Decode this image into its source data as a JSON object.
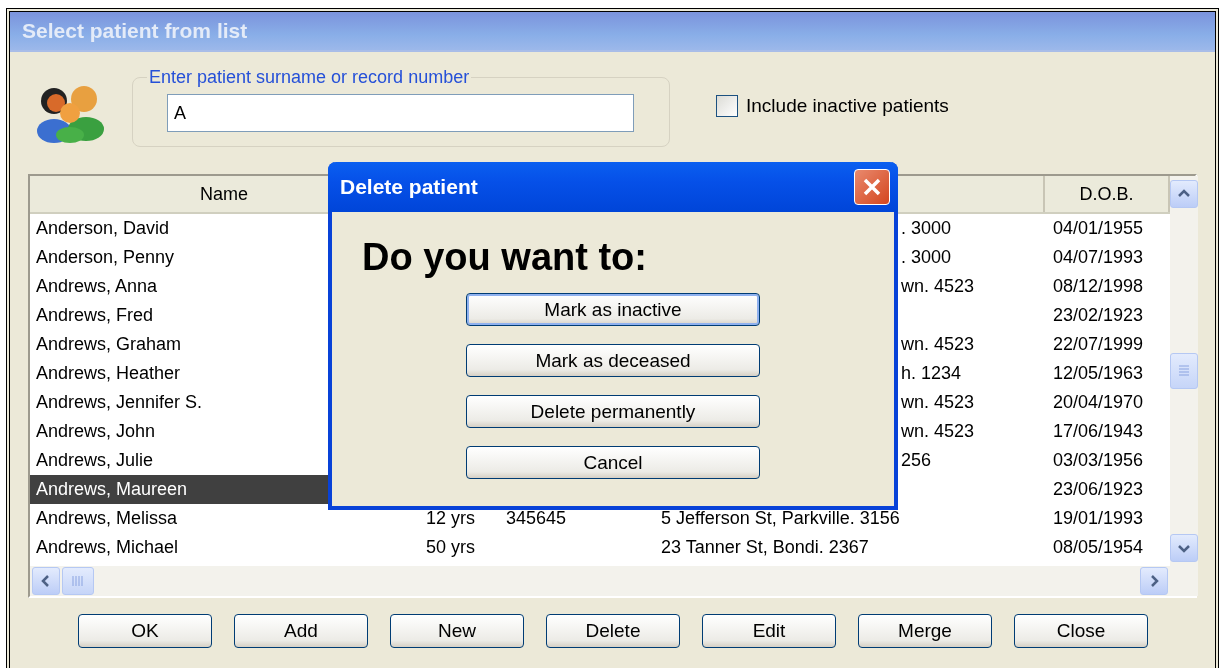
{
  "window": {
    "title": "Select patient from list"
  },
  "search": {
    "legend": "Enter patient surname or record number",
    "value": "A"
  },
  "include_inactive": {
    "label": "Include inactive patients",
    "checked": false
  },
  "table": {
    "columns": [
      {
        "label": "Name"
      },
      {},
      {},
      {},
      {
        "label": "D.O.B."
      }
    ],
    "rows": [
      {
        "name": "Anderson, David",
        "address_tail": ". 3000",
        "dob": "04/01/1955",
        "selected": false
      },
      {
        "name": "Anderson, Penny",
        "address_tail": ". 3000",
        "dob": "04/07/1993",
        "selected": false
      },
      {
        "name": "Andrews, Anna",
        "address_tail": "wn. 4523",
        "dob": "08/12/1998",
        "selected": false
      },
      {
        "name": "Andrews, Fred",
        "dob": "23/02/1923",
        "selected": false
      },
      {
        "name": "Andrews, Graham",
        "address_tail": "wn. 4523",
        "dob": "22/07/1999",
        "selected": false
      },
      {
        "name": "Andrews, Heather",
        "address_tail": "h. 1234",
        "dob": "12/05/1963",
        "selected": false
      },
      {
        "name": "Andrews, Jennifer S.",
        "address_tail": "wn. 4523",
        "dob": "20/04/1970",
        "selected": false
      },
      {
        "name": "Andrews, John",
        "address_tail": "wn. 4523",
        "dob": "17/06/1943",
        "selected": false
      },
      {
        "name": "Andrews, Julie",
        "address_tail": "256",
        "dob": "03/03/1956",
        "selected": false
      },
      {
        "name": "Andrews, Maureen",
        "dob": "23/06/1923",
        "selected": true
      },
      {
        "name": "Andrews, Melissa",
        "age": "12 yrs",
        "record": "345645",
        "address": "5 Jefferson St, Parkville. 3156",
        "dob": "19/01/1993",
        "selected": false
      },
      {
        "name": "Andrews, Michael",
        "age": "50 yrs",
        "address": "23 Tanner St, Bondi. 2367",
        "dob": "08/05/1954",
        "selected": false
      }
    ]
  },
  "buttons": [
    "OK",
    "Add",
    "New",
    "Delete",
    "Edit",
    "Merge",
    "Close"
  ],
  "dialog": {
    "title": "Delete patient",
    "heading": "Do you want to:",
    "buttons": [
      "Mark as inactive",
      "Mark as deceased",
      "Delete permanently",
      "Cancel"
    ]
  }
}
